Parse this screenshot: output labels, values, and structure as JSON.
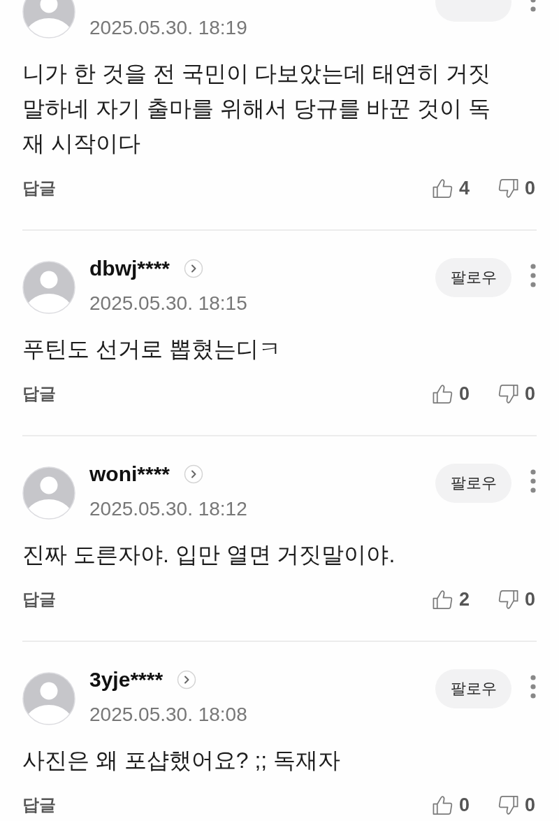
{
  "comments": [
    {
      "timestamp": "2025.05.30. 18:19",
      "body": "니가 한 것을 전 국민이 다보았는데 태연히 거짓 말하네 자기 출마를 위해서 당규를 바꾼 것이 독재 시작이다",
      "reply_label": "답글",
      "likes": "4",
      "dislikes": "0"
    },
    {
      "username": "dbwj****",
      "timestamp": "2025.05.30. 18:15",
      "follow_label": "팔로우",
      "body": "푸틴도 선거로 뽑혔는디ㅋ",
      "reply_label": "답글",
      "likes": "0",
      "dislikes": "0"
    },
    {
      "username": "woni****",
      "timestamp": "2025.05.30. 18:12",
      "follow_label": "팔로우",
      "body": "진짜 도른자야. 입만 열면 거짓말이야.",
      "reply_label": "답글",
      "likes": "2",
      "dislikes": "0"
    },
    {
      "username": "3yje****",
      "timestamp": "2025.05.30. 18:08",
      "follow_label": "팔로우",
      "body": "사진은 왜 포샵했어요? ;; 독재자",
      "reply_label": "답글",
      "likes": "0",
      "dislikes": "0"
    }
  ]
}
